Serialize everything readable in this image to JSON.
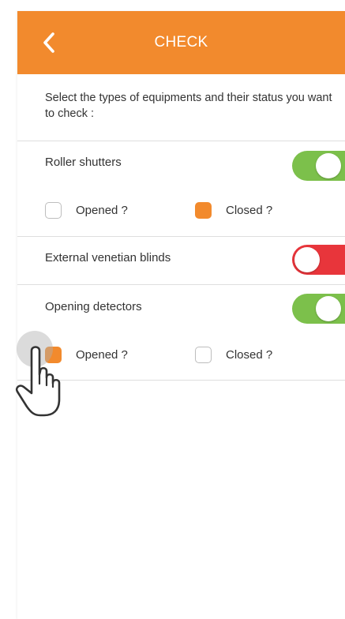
{
  "colors": {
    "accent": "#f28a2d",
    "toggle_on": "#7cc04b",
    "toggle_off": "#e8353b"
  },
  "header": {
    "title": "CHECK",
    "back_icon": "chevron-left-icon"
  },
  "intro_text": "Select the types of equipments and their status you want to check :",
  "sections": [
    {
      "label": "Roller shutters",
      "enabled": true,
      "options": [
        {
          "label": "Opened ?",
          "checked": false
        },
        {
          "label": "Closed ?",
          "checked": true
        }
      ]
    },
    {
      "label": "External venetian blinds",
      "enabled": false,
      "options": []
    },
    {
      "label": "Opening detectors",
      "enabled": true,
      "options": [
        {
          "label": "Opened ?",
          "checked": true
        },
        {
          "label": "Closed ?",
          "checked": false
        }
      ]
    }
  ],
  "overlay": {
    "cursor_icon": "hand-pointer-icon"
  }
}
